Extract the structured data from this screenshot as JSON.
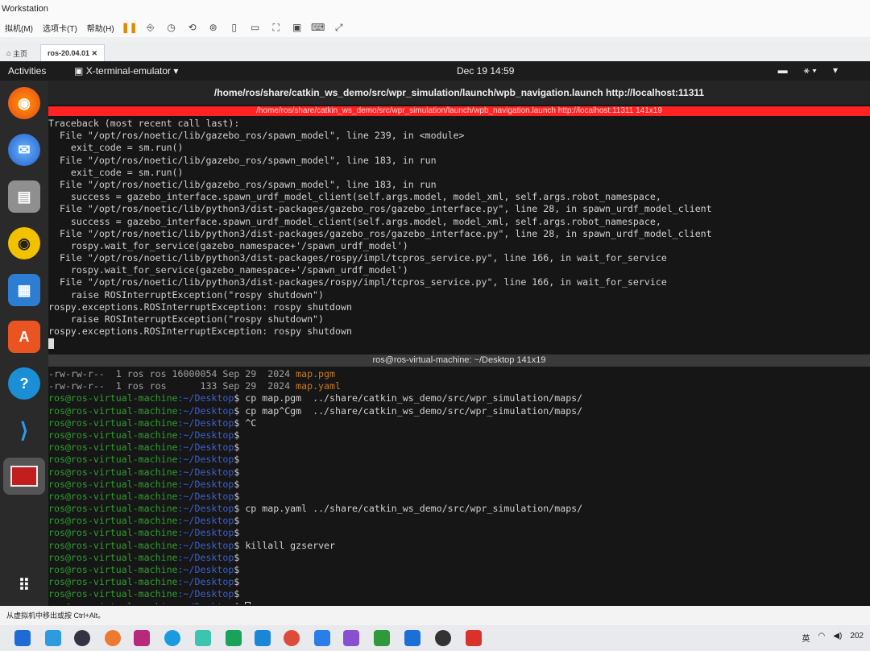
{
  "vmware": {
    "title": "Workstation",
    "menu": [
      "拟机(M)",
      "选项卡(T)",
      "帮助(H)"
    ],
    "tabs": [
      {
        "label": "主页"
      },
      {
        "label": "ros-20.04.01"
      }
    ],
    "status_hint": "从虚拟机中移出或按 Ctrl+Alt。"
  },
  "ubuntu": {
    "activities": "Activities",
    "app_menu": "X-terminal-emulator ▾",
    "clock": "Dec 19  14:59",
    "dock_apps": [
      "firefox-icon",
      "thunderbird-icon",
      "files-icon",
      "rhythmbox-icon",
      "writer-icon",
      "software-center-icon",
      "help-icon",
      "vscode-icon",
      "terminator-icon",
      "show-apps-icon"
    ]
  },
  "terminal": {
    "window_title": "/home/ros/share/catkin_ws_demo/src/wpr_simulation/launch/wpb_navigation.launch http://localhost:11311",
    "pane1_title": "/home/ros/share/catkin_ws_demo/src/wpr_simulation/launch/wpb_navigation.launch http://localhost:11311 141x19",
    "pane1_lines": [
      "Traceback (most recent call last):",
      "  File \"/opt/ros/noetic/lib/gazebo_ros/spawn_model\", line 239, in <module>",
      "    exit_code = sm.run()",
      "  File \"/opt/ros/noetic/lib/gazebo_ros/spawn_model\", line 183, in run",
      "    exit_code = sm.run()",
      "  File \"/opt/ros/noetic/lib/gazebo_ros/spawn_model\", line 183, in run",
      "    success = gazebo_interface.spawn_urdf_model_client(self.args.model, model_xml, self.args.robot_namespace,",
      "  File \"/opt/ros/noetic/lib/python3/dist-packages/gazebo_ros/gazebo_interface.py\", line 28, in spawn_urdf_model_client",
      "    success = gazebo_interface.spawn_urdf_model_client(self.args.model, model_xml, self.args.robot_namespace,",
      "  File \"/opt/ros/noetic/lib/python3/dist-packages/gazebo_ros/gazebo_interface.py\", line 28, in spawn_urdf_model_client",
      "    rospy.wait_for_service(gazebo_namespace+'/spawn_urdf_model')",
      "  File \"/opt/ros/noetic/lib/python3/dist-packages/rospy/impl/tcpros_service.py\", line 166, in wait_for_service",
      "    rospy.wait_for_service(gazebo_namespace+'/spawn_urdf_model')",
      "  File \"/opt/ros/noetic/lib/python3/dist-packages/rospy/impl/tcpros_service.py\", line 166, in wait_for_service",
      "    raise ROSInterruptException(\"rospy shutdown\")",
      "rospy.exceptions.ROSInterruptException: rospy shutdown",
      "    raise ROSInterruptException(\"rospy shutdown\")",
      "rospy.exceptions.ROSInterruptException: rospy shutdown"
    ],
    "pane2_title": "ros@ros-virtual-machine: ~/Desktop 141x19",
    "ls_lines": [
      {
        "meta": "-rw-rw-r--  1 ros ros 16000054 Sep 29  2024 ",
        "file": "map.pgm"
      },
      {
        "meta": "-rw-rw-r--  1 ros ros      133 Sep 29  2024 ",
        "file": "map.yaml"
      }
    ],
    "prompt_user": "ros@ros-virtual-machine",
    "prompt_path": ":~/Desktop",
    "prompt_symbol": "$ ",
    "commands": [
      "cp map.pgm  ../share/catkin_ws_demo/src/wpr_simulation/maps/",
      "cp map^Cgm  ../share/catkin_ws_demo/src/wpr_simulation/maps/",
      "^C",
      "",
      "",
      "",
      "",
      "",
      "",
      "cp map.yaml ../share/catkin_ws_demo/src/wpr_simulation/maps/",
      "",
      "",
      "killall gzserver",
      "",
      "",
      "",
      ""
    ]
  },
  "host_taskbar": {
    "ime": "英",
    "year_fragment": "202"
  }
}
